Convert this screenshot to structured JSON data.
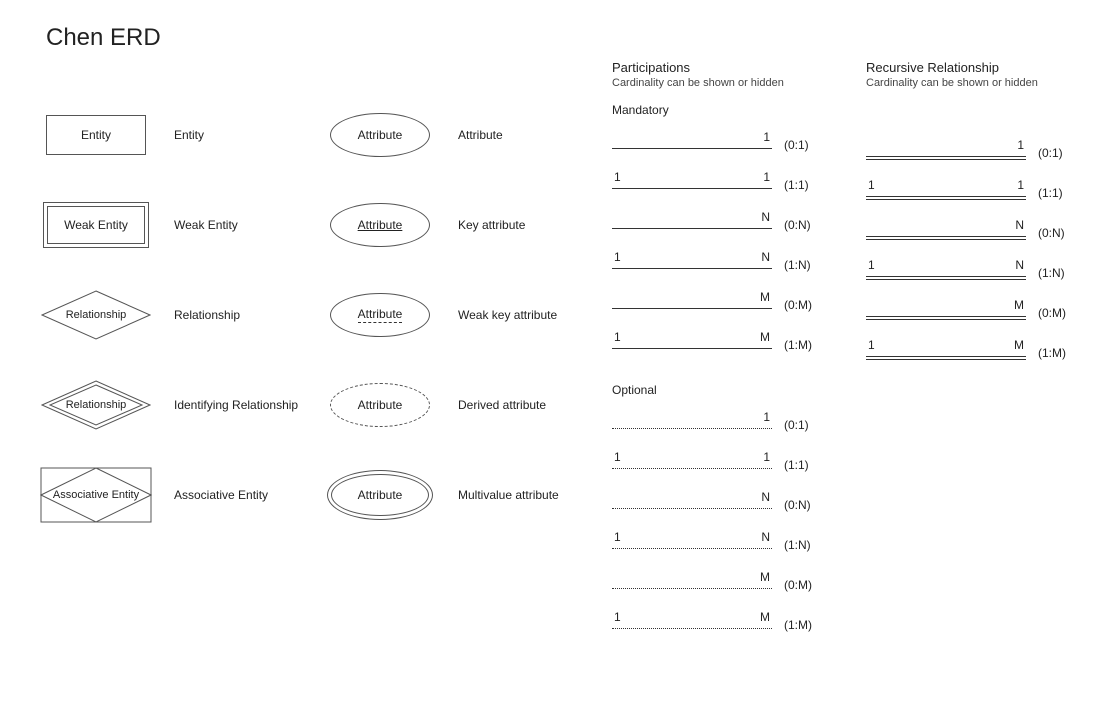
{
  "title": "Chen ERD",
  "shapes_col1": [
    {
      "shape_text": "Entity",
      "label": "Entity"
    },
    {
      "shape_text": "Weak Entity",
      "label": "Weak Entity"
    },
    {
      "shape_text": "Relationship",
      "label": "Relationship"
    },
    {
      "shape_text": "Relationship",
      "label": "Identifying Relationship"
    },
    {
      "shape_text": "Associative Entity",
      "label": "Associative Entity"
    }
  ],
  "shapes_col2": [
    {
      "shape_text": "Attribute",
      "label": "Attribute"
    },
    {
      "shape_text": "Attribute",
      "label": "Key attribute"
    },
    {
      "shape_text": "Attribute",
      "label": "Weak key attribute"
    },
    {
      "shape_text": "Attribute",
      "label": "Derived attribute"
    },
    {
      "shape_text": "Attribute",
      "label": "Multivalue attribute"
    }
  ],
  "participations": {
    "heading": "Participations",
    "sub": "Cardinality can be shown or hidden",
    "mandatory_label": "Mandatory",
    "optional_label": "Optional",
    "rows": [
      {
        "left": "",
        "right": "1",
        "card": "(0:1)"
      },
      {
        "left": "1",
        "right": "1",
        "card": "(1:1)"
      },
      {
        "left": "",
        "right": "N",
        "card": "(0:N)"
      },
      {
        "left": "1",
        "right": "N",
        "card": "(1:N)"
      },
      {
        "left": "",
        "right": "M",
        "card": "(0:M)"
      },
      {
        "left": "1",
        "right": "M",
        "card": "(1:M)"
      }
    ]
  },
  "recursive": {
    "heading": "Recursive Relationship",
    "sub": "Cardinality can be shown or hidden",
    "rows": [
      {
        "left": "",
        "right": "1",
        "card": "(0:1)"
      },
      {
        "left": "1",
        "right": "1",
        "card": "(1:1)"
      },
      {
        "left": "",
        "right": "N",
        "card": "(0:N)"
      },
      {
        "left": "1",
        "right": "N",
        "card": "(1:N)"
      },
      {
        "left": "",
        "right": "M",
        "card": "(0:M)"
      },
      {
        "left": "1",
        "right": "M",
        "card": "(1:M)"
      }
    ]
  }
}
